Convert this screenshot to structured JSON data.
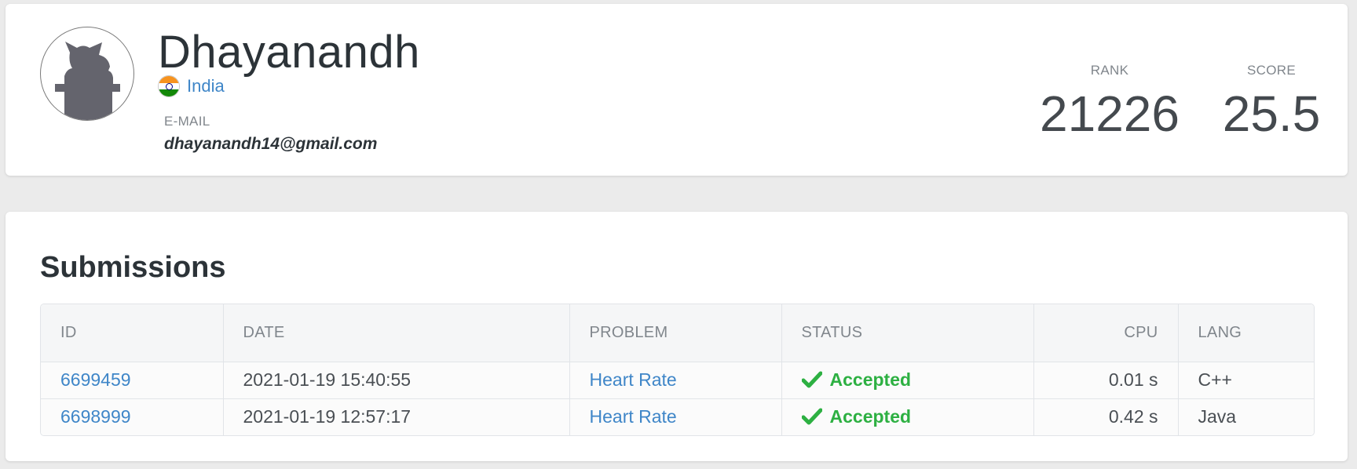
{
  "profile": {
    "username": "Dhayanandh",
    "country": "India",
    "email_label": "E-MAIL",
    "email": "dhayanandh14@gmail.com",
    "avatar_icon": "default-cat-avatar-icon",
    "flag_icon": "india-flag-icon"
  },
  "stats": {
    "rank_label": "RANK",
    "rank_value": "21226",
    "score_label": "SCORE",
    "score_value": "25.5"
  },
  "submissions": {
    "title": "Submissions",
    "columns": [
      "ID",
      "DATE",
      "PROBLEM",
      "STATUS",
      "CPU",
      "LANG"
    ],
    "rows": [
      {
        "id": "6699459",
        "date": "2021-01-19 15:40:55",
        "problem": "Heart Rate",
        "status": "Accepted",
        "cpu": "0.01 s",
        "lang": "C++"
      },
      {
        "id": "6698999",
        "date": "2021-01-19 12:57:17",
        "problem": "Heart Rate",
        "status": "Accepted",
        "cpu": "0.42 s",
        "lang": "Java"
      }
    ]
  },
  "colors": {
    "link": "#3f86c8",
    "accepted": "#2db042",
    "background": "#ebebeb"
  }
}
